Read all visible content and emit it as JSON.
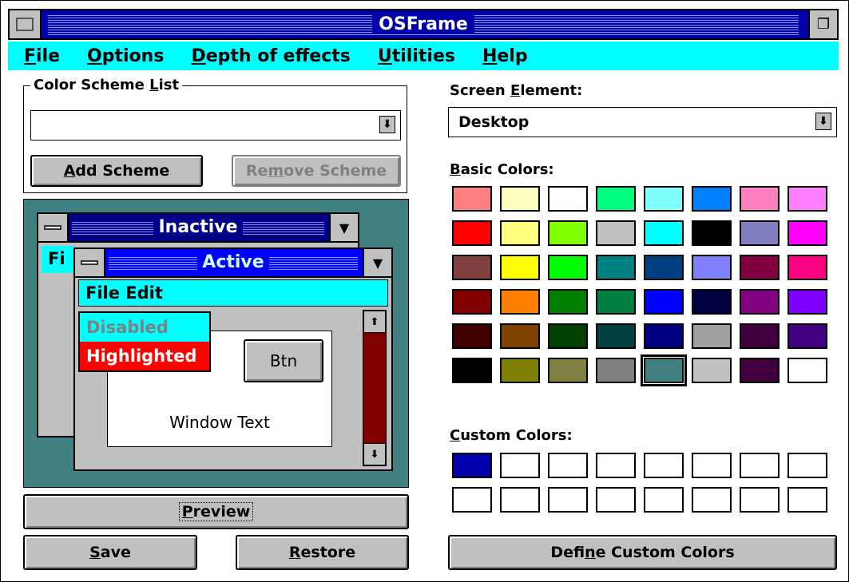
{
  "window": {
    "title": "OSFrame",
    "maximize_icon": "restore-icon"
  },
  "menu": {
    "items": [
      "File",
      "Options",
      "Depth of effects",
      "Utilities",
      "Help"
    ],
    "mnemonics": [
      "F",
      "O",
      "D",
      "U",
      "H"
    ]
  },
  "scheme": {
    "group_label": "Color Scheme List",
    "value": "",
    "add_label": "Add Scheme",
    "remove_label": "Remove Scheme"
  },
  "preview_window": {
    "inactive_title": "Inactive",
    "inactive_menu_text": "Fi",
    "active_title": "Active",
    "active_menu": "File  Edit",
    "disabled_label": "Disabled",
    "highlighted_label": "Highlighted",
    "button_label": "Btn",
    "window_text": "Window Text"
  },
  "actions": {
    "preview_label": "Preview",
    "save_label": "Save",
    "restore_label": "Restore",
    "define_custom_label": "Define Custom Colors"
  },
  "screen_element": {
    "label": "Screen Element:",
    "value": "Desktop"
  },
  "basic_colors": {
    "label": "Basic Colors:",
    "selected_index": 44,
    "colors": [
      "#ff8080",
      "#ffffc0",
      "#ffffff",
      "#00ff80",
      "#80ffff",
      "#0080ff",
      "#ff80c0",
      "#ff80ff",
      "#ff0000",
      "#ffff80",
      "#80ff00",
      "#c0c0c0",
      "#00ffff",
      "#000000",
      "#8080c0",
      "#ff00ff",
      "#804040",
      "#ffff00",
      "#00ff00",
      "#008080",
      "#004080",
      "#8080ff",
      "#800040",
      "#ff0080",
      "#800000",
      "#ff8000",
      "#008000",
      "#008040",
      "#0000ff",
      "#000040",
      "#800080",
      "#8000ff",
      "#400000",
      "#804000",
      "#004000",
      "#004040",
      "#000080",
      "#a0a0a0",
      "#400040",
      "#400080",
      "#000000",
      "#808000",
      "#808040",
      "#808080",
      "#408080",
      "#c0c0c0",
      "#400040",
      "#ffffff"
    ]
  },
  "custom_colors": {
    "label": "Custom Colors:",
    "colors": [
      "#0000aa",
      "#ffffff",
      "#ffffff",
      "#ffffff",
      "#ffffff",
      "#ffffff",
      "#ffffff",
      "#ffffff",
      "#ffffff",
      "#ffffff",
      "#ffffff",
      "#ffffff",
      "#ffffff",
      "#ffffff",
      "#ffffff",
      "#ffffff"
    ]
  }
}
